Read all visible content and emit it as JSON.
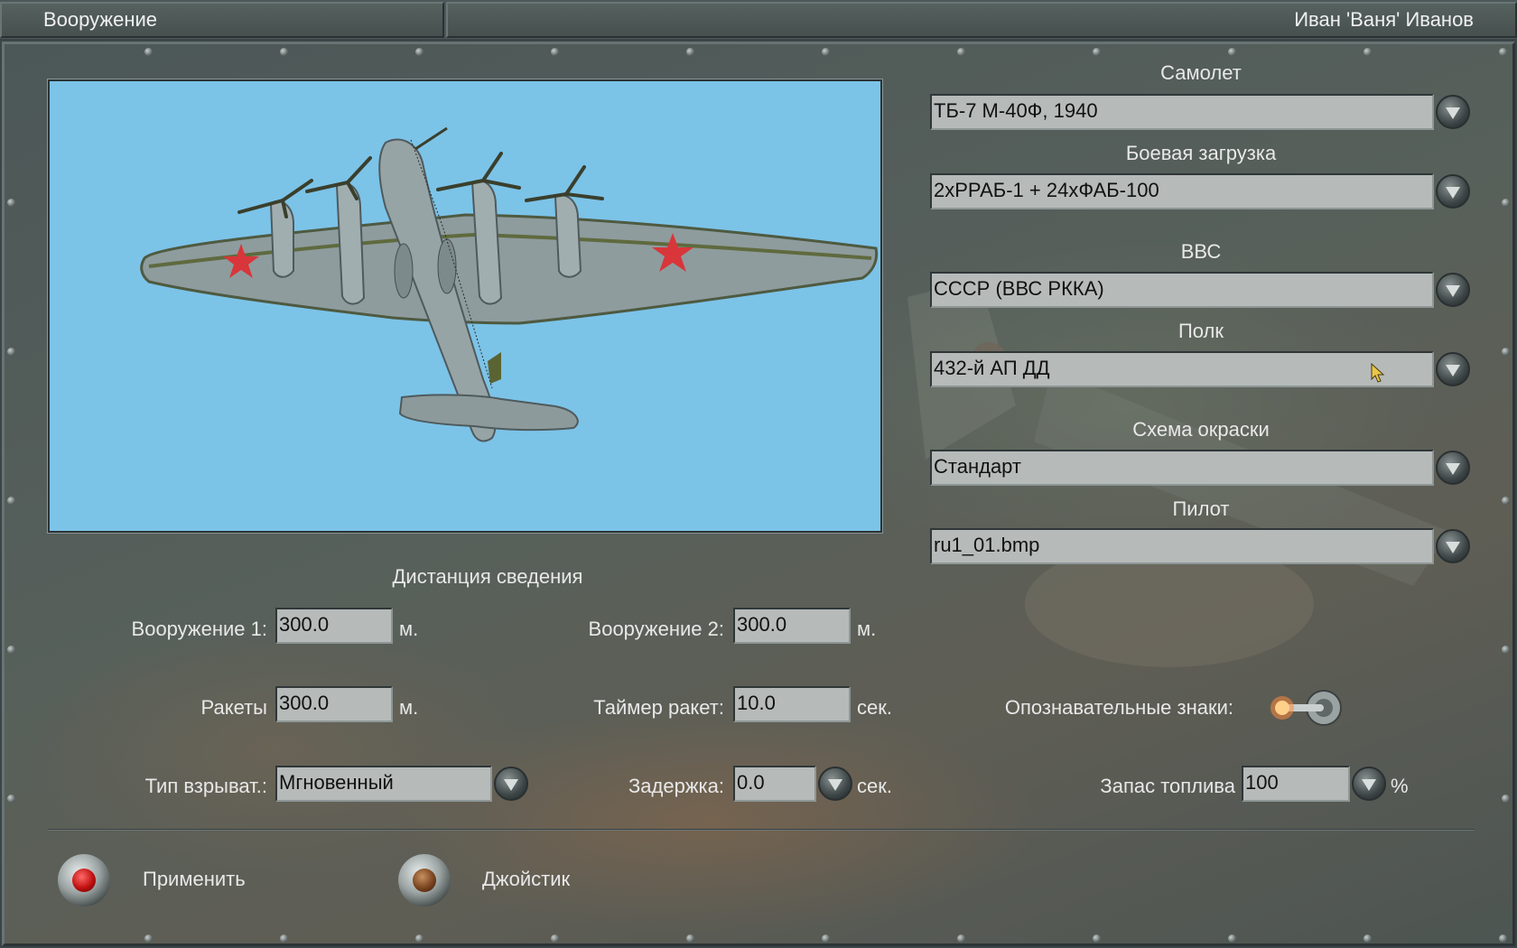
{
  "window": {
    "title": "Вооружение",
    "player": "Иван 'Ваня' Иванов"
  },
  "aircraft_settings": {
    "plane": {
      "label": "Самолет",
      "value": "ТБ-7 М-40Ф, 1940"
    },
    "loadout": {
      "label": "Боевая загрузка",
      "value": "2хРРАБ-1 + 24хФАБ-100"
    },
    "air_force": {
      "label": "ВВС",
      "value": "СССР (ВВС РККА)"
    },
    "regiment": {
      "label": "Полк",
      "value": "432-й АП ДД"
    },
    "skin": {
      "label": "Схема окраски",
      "value": "Стандарт"
    },
    "pilot": {
      "label": "Пилот",
      "value": "ru1_01.bmp"
    }
  },
  "convergence": {
    "heading": "Дистанция сведения",
    "weapon1": {
      "label": "Вооружение 1:",
      "value": "300.0",
      "unit": "м."
    },
    "weapon2": {
      "label": "Вооружение 2:",
      "value": "300.0",
      "unit": "м."
    },
    "rockets": {
      "label": "Ракеты",
      "value": "300.0",
      "unit": "м."
    },
    "rocket_timer": {
      "label": "Таймер ракет:",
      "value": "10.0",
      "unit": "сек."
    },
    "fuse_type": {
      "label": "Тип взрыват.:",
      "value": "Мгновенный"
    },
    "delay": {
      "label": "Задержка:",
      "value": "0.0",
      "unit": "сек."
    },
    "markings": {
      "label": "Опознавательные знаки:",
      "enabled": true
    },
    "fuel": {
      "label": "Запас топлива",
      "value": "100",
      "unit": "%"
    }
  },
  "buttons": {
    "apply": "Применить",
    "joystick": "Джойстик"
  },
  "colors": {
    "panel": "#4c5758",
    "preview_sky": "#7cc3e8",
    "field": "#b6bbba",
    "star": "#d8363a"
  }
}
